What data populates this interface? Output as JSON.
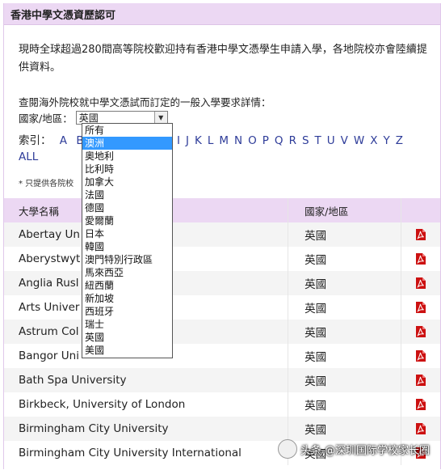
{
  "header": {
    "title": "香港中學文憑資歷認可"
  },
  "intro": {
    "text": "現時全球超過280間高等院校歡迎持有香港中學文憑學生申請入學，各地院校亦會陸續提供資料。"
  },
  "query": {
    "text": "查閱海外院校就中學文憑試而訂定的一般入學要求詳情：",
    "country_label": "國家/地區：",
    "selected_value": "英國"
  },
  "index": {
    "label": "索引：",
    "letters_left": [
      "A",
      "B"
    ],
    "letters_right": [
      "I",
      "J",
      "K",
      "L",
      "M",
      "N",
      "O",
      "P",
      "Q",
      "R",
      "S",
      "T",
      "U",
      "V",
      "W",
      "X",
      "Y",
      "Z"
    ],
    "all_label": "ALL"
  },
  "note": "* 只提供各院校",
  "table": {
    "headers": {
      "name": "大學名稱",
      "country": "國家/地區"
    },
    "rows": [
      {
        "name": "Abertay Un",
        "country": "英國",
        "style": "odd"
      },
      {
        "name": "Aberystwyt",
        "country": "英國",
        "style": "even"
      },
      {
        "name": "Anglia Rusl",
        "country": "英國",
        "style": "odd"
      },
      {
        "name": "Arts Univer                         n",
        "country": "英國",
        "style": "even"
      },
      {
        "name": "Astrum Col",
        "country": "英國",
        "style": "odd"
      },
      {
        "name": "Bangor Uni",
        "country": "英國",
        "style": "even"
      },
      {
        "name": "Bath Spa University",
        "country": "英國",
        "style": "odd"
      },
      {
        "name": "Birkbeck, University of London",
        "country": "英國",
        "style": "even"
      },
      {
        "name": "Birmingham City University",
        "country": "英國",
        "style": "odd"
      },
      {
        "name": "Birmingham City University International",
        "country": "英國",
        "style": "even"
      }
    ]
  },
  "dropdown": {
    "options": [
      "所有",
      "澳洲",
      "奧地利",
      "比利時",
      "加拿大",
      "法國",
      "德國",
      "愛爾蘭",
      "日本",
      "韓國",
      "澳門特別行政區",
      "馬來西亞",
      "紐西蘭",
      "新加坡",
      "西班牙",
      "瑞士",
      "英國",
      "美國"
    ],
    "highlighted_index": 1
  },
  "watermark": {
    "text": "头条 @深圳国际学校家长圈"
  },
  "colors": {
    "header_bg": "#ecd8f3",
    "link": "#2e3c99",
    "highlight": "#3399ff",
    "pdf_red": "#cc1111"
  }
}
